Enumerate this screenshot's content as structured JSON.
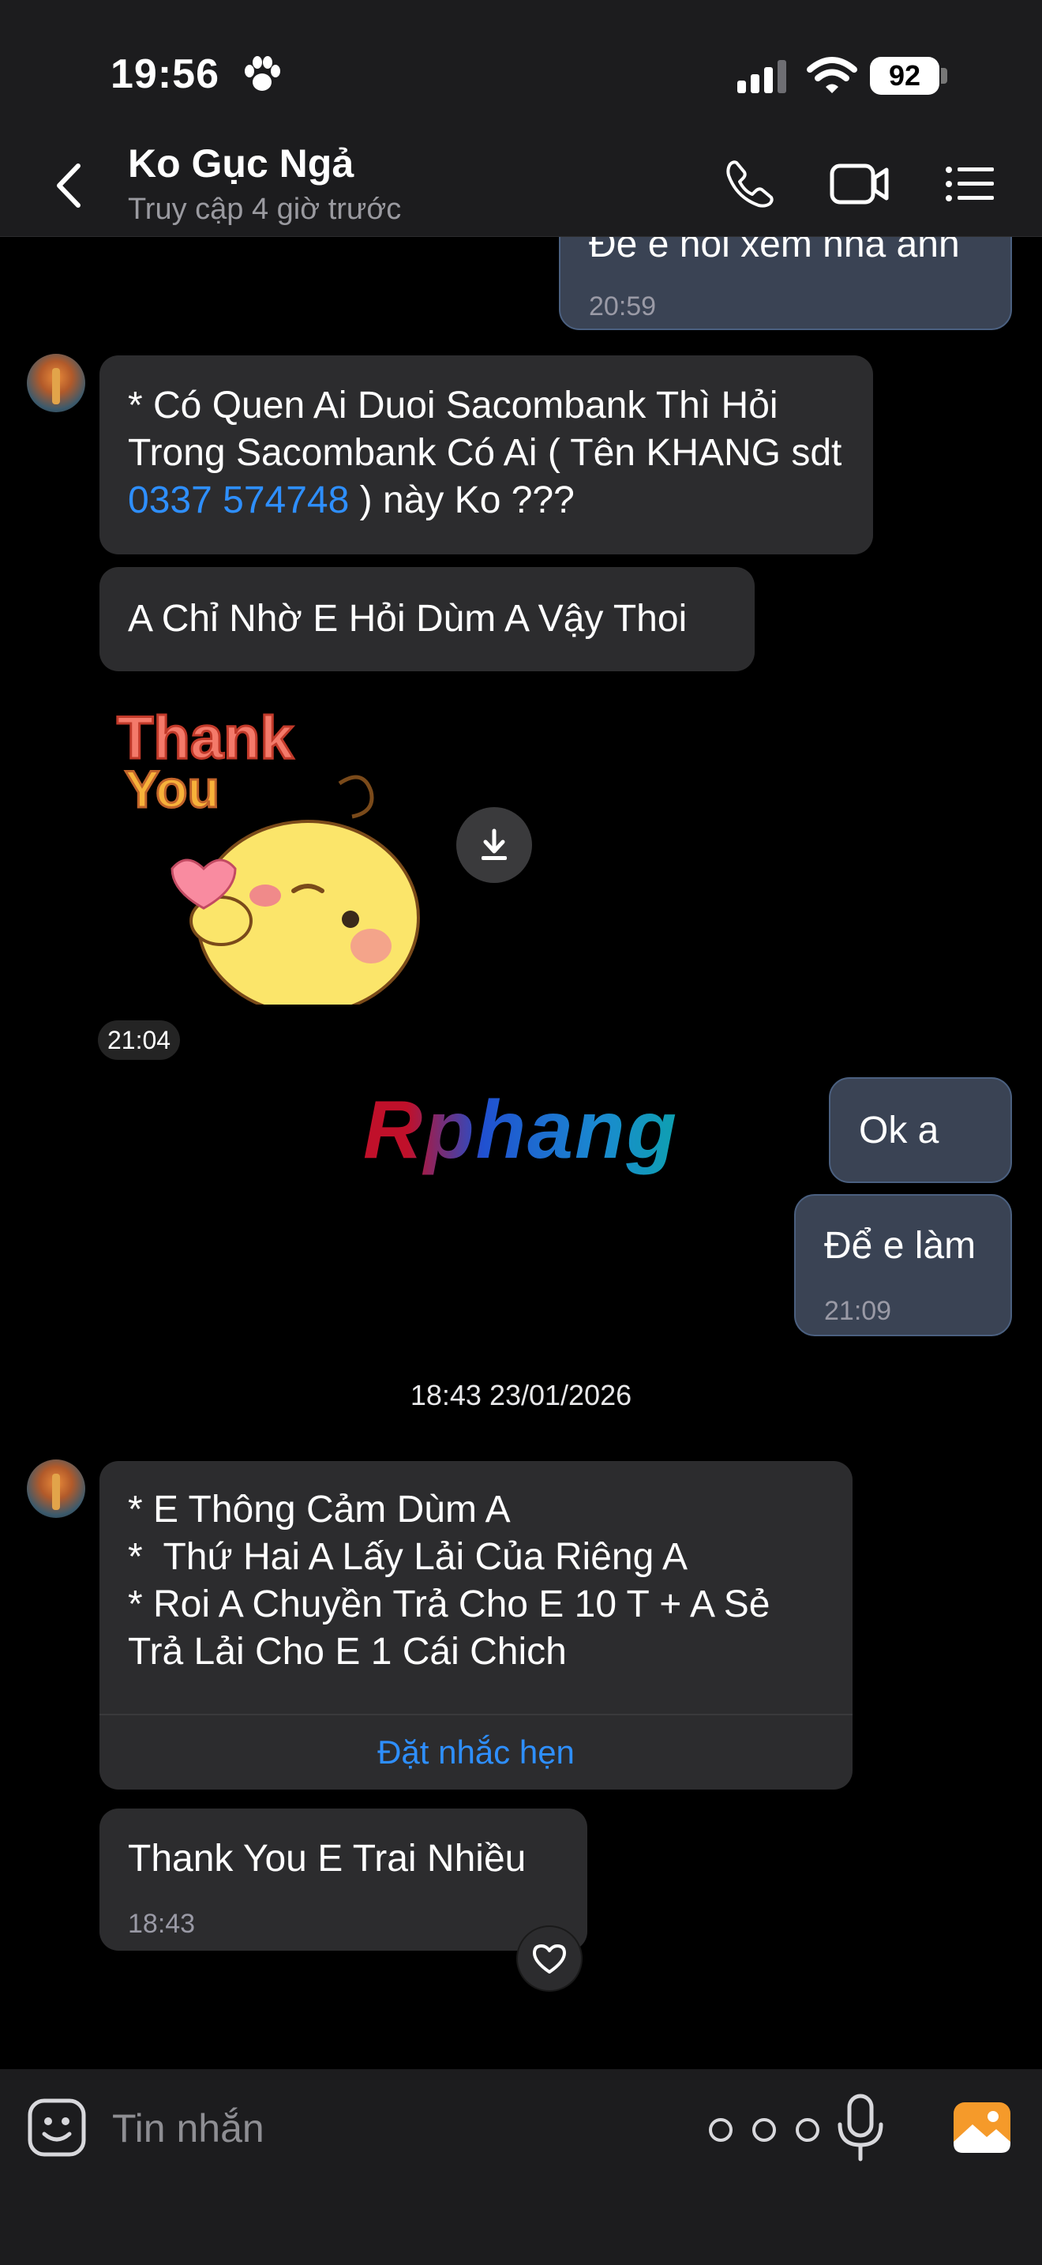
{
  "status_bar": {
    "time": "19:56",
    "battery": "92"
  },
  "header": {
    "title": "Ko Gục Ngả",
    "subtitle": "Truy cập 4 giờ trước"
  },
  "messages": {
    "top_partial": {
      "text": "Để e hỏi xem nha anh",
      "time": "20:59"
    },
    "incoming_1": {
      "text_before": "* Có Quen Ai Duoi Sacombank Thì Hỏi Trong Sacombank Có Ai ( Tên KHANG sdt ",
      "phone": "0337 574748",
      "text_after": " ) này Ko ???"
    },
    "incoming_2": {
      "text": "A Chỉ Nhờ E Hỏi Dùm A Vậy Thoi"
    },
    "sticker": {
      "line1": "Thank",
      "line2": "You",
      "time": "21:04"
    },
    "outgoing_1": {
      "text": "Ok a"
    },
    "outgoing_2": {
      "text": "Để e làm",
      "time": "21:09"
    },
    "date_separator": "18:43 23/01/2026",
    "incoming_3": {
      "lines": [
        "* E Thông Cảm Dùm A",
        "*  Thứ Hai A Lấy Lải Của Riêng A",
        "* Roi A Chuyền Trả Cho E 10 T + A Sẻ Trả Lải Cho E 1 Cái Chich"
      ],
      "action": "Đặt nhắc hẹn"
    },
    "incoming_4": {
      "text": "Thank You E Trai Nhiều",
      "time": "18:43"
    }
  },
  "watermark": "Rphang",
  "input": {
    "placeholder": "Tin nhắn"
  },
  "colors": {
    "background": "#000000",
    "incoming_bubble": "#2c2c2e",
    "outgoing_bubble": "#3a4354",
    "link": "#2e8fff",
    "photo_icon": "#f59a2a"
  },
  "icons": [
    "paw-icon",
    "signal-icon",
    "wifi-icon",
    "back-icon",
    "phone-icon",
    "video-icon",
    "list-icon",
    "download-icon",
    "heart-icon",
    "emoji-icon",
    "more-icon",
    "mic-icon",
    "photo-icon"
  ]
}
